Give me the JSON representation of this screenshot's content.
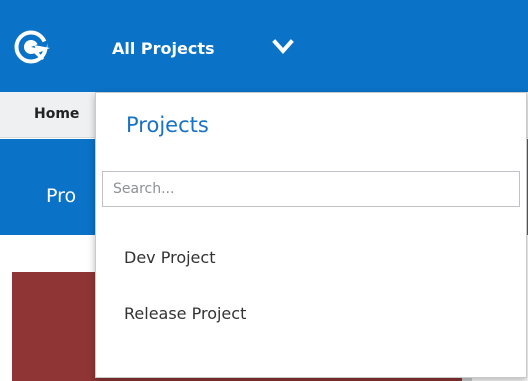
{
  "header": {
    "project_switcher_label": "All Projects"
  },
  "subnav": {
    "home_label": "Home"
  },
  "title_band": {
    "text": "Pro"
  },
  "dropdown": {
    "title": "Projects",
    "search": {
      "placeholder": "Search...",
      "value": ""
    },
    "items": [
      {
        "label": "Dev Project"
      },
      {
        "label": "Release Project"
      }
    ]
  },
  "colors": {
    "header_blue": "#0a72c7",
    "link_blue": "#1a72c4",
    "card_red": "#8f3535",
    "subnav_gray": "#eef0f2"
  },
  "icons": {
    "logo": "app-logo-icon",
    "chevron": "chevron-down-icon"
  }
}
